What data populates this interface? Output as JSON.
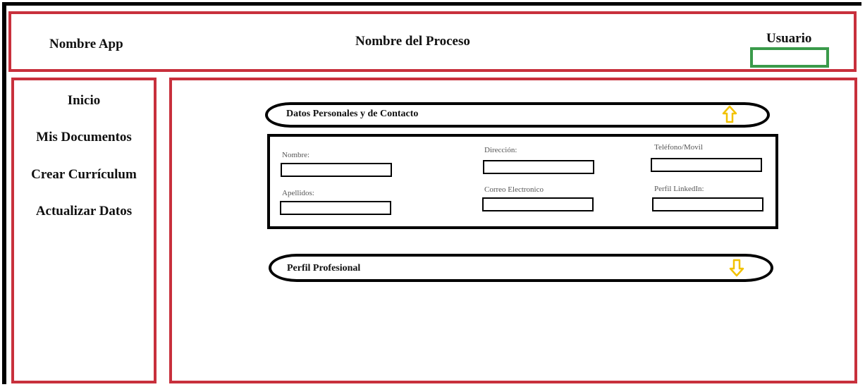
{
  "header": {
    "app_name": "Nombre App",
    "process_name": "Nombre del Proceso",
    "user_label": "Usuario",
    "user_value": ""
  },
  "sidebar": {
    "items": [
      {
        "label": "Inicio"
      },
      {
        "label": "Mis Documentos"
      },
      {
        "label": "Crear Currículum"
      },
      {
        "label": "Actualizar Datos"
      }
    ]
  },
  "sections": {
    "personal": {
      "title": "Datos Personales y de Contacto",
      "arrow": "up-arrow-icon"
    },
    "professional": {
      "title": "Perfil Profesional",
      "arrow": "down-arrow-icon"
    }
  },
  "form": {
    "nombre": {
      "label": "Nombre:",
      "value": ""
    },
    "apellidos": {
      "label": "Apellidos:",
      "value": ""
    },
    "direccion": {
      "label": "Dirección:",
      "value": ""
    },
    "correo": {
      "label": "Correo Electronico",
      "value": ""
    },
    "telefono": {
      "label": "Teléfono/Movil",
      "value": ""
    },
    "linkedin": {
      "label": "Perfil LinkedIn:",
      "value": ""
    }
  },
  "colors": {
    "panel_border": "#c8303c",
    "user_box_border": "#3a9a4a",
    "arrow": "#f2c200"
  }
}
